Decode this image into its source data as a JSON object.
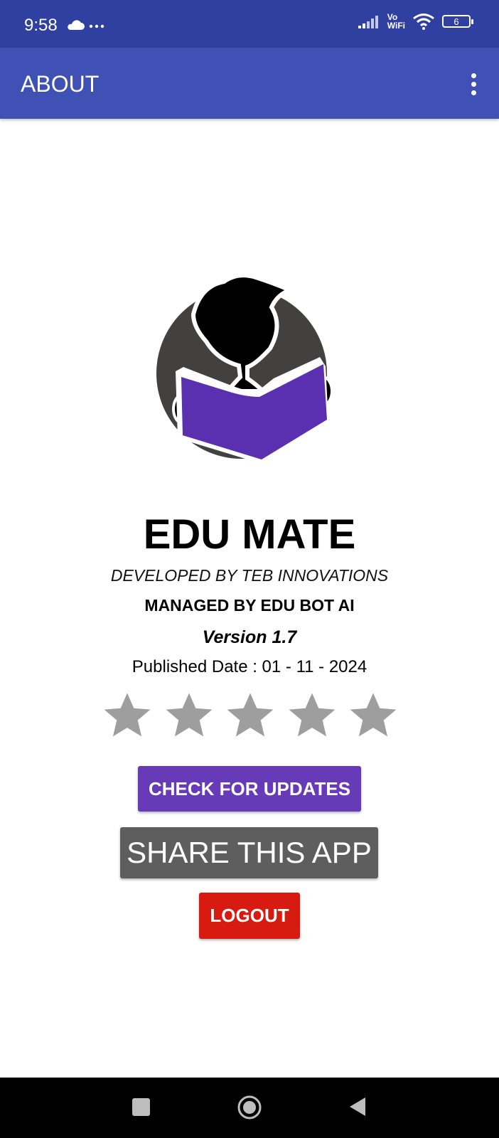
{
  "status_bar": {
    "time": "9:58",
    "left_icons": [
      "cloud-icon",
      "more-dots-icon"
    ],
    "vo_line1": "Vo",
    "vo_line2": "WiFi",
    "battery_level": "6"
  },
  "app_bar": {
    "title": "ABOUT",
    "overflow_icon": "more-vert-icon"
  },
  "about": {
    "app_name": "EDU MATE",
    "developer": "DEVELOPED BY TEB INNOVATIONS",
    "managed": "MANAGED BY EDU BOT AI",
    "version": "Version 1.7",
    "published": "Published Date : 01 - 11 - 2024"
  },
  "rating": {
    "max_stars": 5,
    "filled_stars": 0,
    "star_color": "#9e9e9e"
  },
  "buttons": {
    "check_updates": "CHECK FOR UPDATES",
    "share": "SHARE THIS APP",
    "logout": "LOGOUT"
  },
  "colors": {
    "status_bar": "#3040a0",
    "app_bar": "#3f51b5",
    "update_button": "#673ab7",
    "share_button": "#5e5e5e",
    "logout_button": "#d81b10",
    "logo_book": "#5a2fb0",
    "logo_circle": "#434040"
  },
  "nav_bar": {
    "icons": [
      "recent-apps-icon",
      "home-icon",
      "back-icon"
    ]
  }
}
